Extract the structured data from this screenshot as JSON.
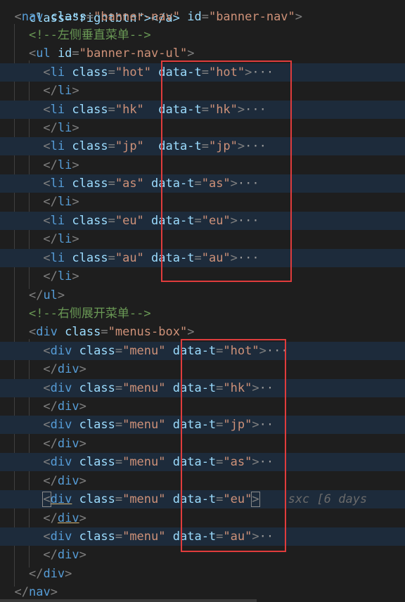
{
  "code": {
    "line0": "class=\"rightbtn\"></a>",
    "nav_open": {
      "tag": "nav",
      "attr": "class",
      "val": "\"banner-nav\"",
      "attr2": "id",
      "val2": "\"banner-nav\""
    },
    "cmt_left": "<!--左侧垂直菜单-->",
    "ul_open": {
      "tag": "ul",
      "attr": "id",
      "val": "\"banner-nav-ul\""
    },
    "li_items": [
      {
        "cls": "\"hot\"",
        "dt": "\"hot\""
      },
      {
        "cls": "\"hk\"",
        "dt": "\"hk\""
      },
      {
        "cls": "\"jp\"",
        "dt": "\"jp\""
      },
      {
        "cls": "\"as\"",
        "dt": "\"as\""
      },
      {
        "cls": "\"eu\"",
        "dt": "\"eu\""
      },
      {
        "cls": "\"au\"",
        "dt": "\"au\""
      }
    ],
    "cmt_right": "<!--右侧展开菜单-->",
    "menus_box": {
      "tag": "div",
      "attr": "class",
      "val": "\"menus-box\""
    },
    "menu_items": [
      {
        "cls": "\"menu\"",
        "dt": "\"hot\""
      },
      {
        "cls": "\"menu\"",
        "dt": "\"hk\""
      },
      {
        "cls": "\"menu\"",
        "dt": "\"jp\""
      },
      {
        "cls": "\"menu\"",
        "dt": "\"as\""
      },
      {
        "cls": "\"menu\"",
        "dt": "\"eu\""
      },
      {
        "cls": "\"menu\"",
        "dt": "\"au\""
      }
    ],
    "kw": {
      "li": "li",
      "div": "div",
      "ul": "ul",
      "nav": "nav",
      "class": "class",
      "data_t": "data-t"
    },
    "fold": "···",
    "fold_short": "··",
    "blame": "sxc [6 days"
  },
  "colors": {
    "background": "#1e1e1e",
    "tag": "#569cd6",
    "attr": "#9cdcfe",
    "string": "#ce9178",
    "comment": "#6a9955",
    "highlight": "#e03c3c"
  }
}
